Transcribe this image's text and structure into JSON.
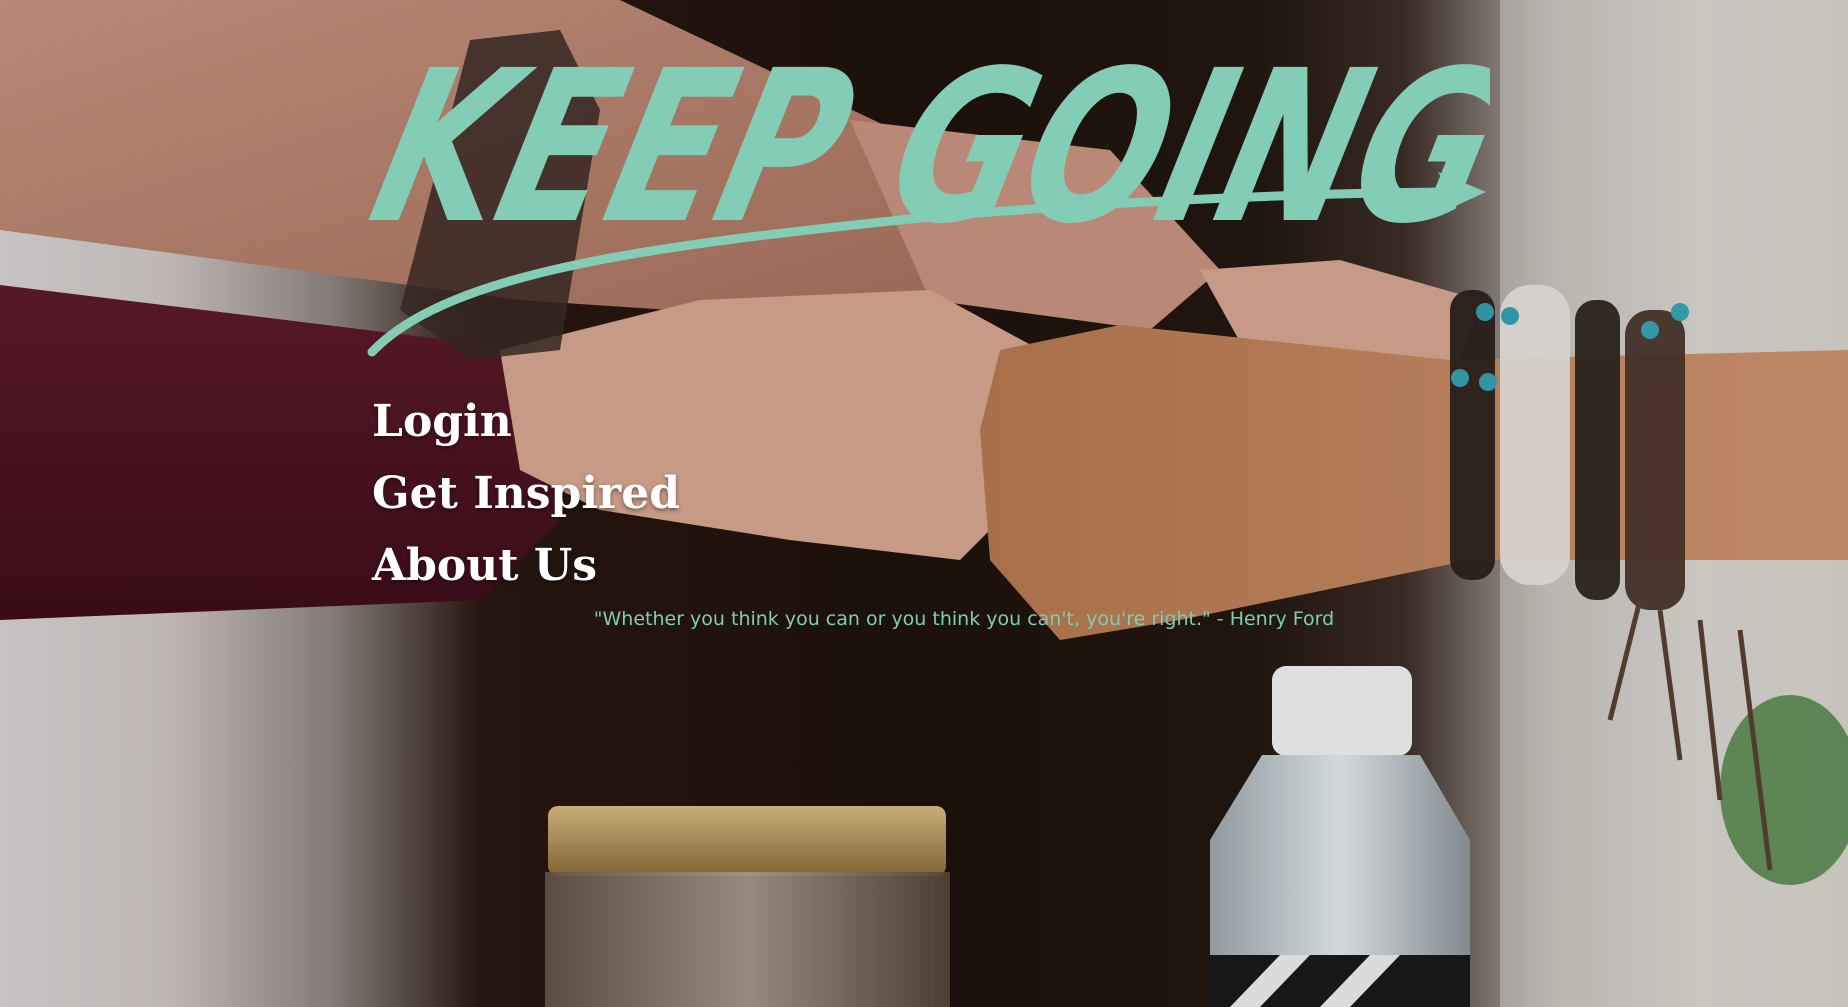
{
  "brand": {
    "logo_text": "KEEP GOING",
    "logo_color": "#83cdb6"
  },
  "nav": {
    "items": [
      {
        "label": "Login"
      },
      {
        "label": "Get Inspired"
      },
      {
        "label": "About Us"
      }
    ]
  },
  "quote": {
    "text": "\"Whether you think you can or you think you can't, you're right.\" - Henry Ford",
    "color": "#7ecdb6"
  },
  "background": {
    "description_icon": "fist-bump-photo"
  }
}
